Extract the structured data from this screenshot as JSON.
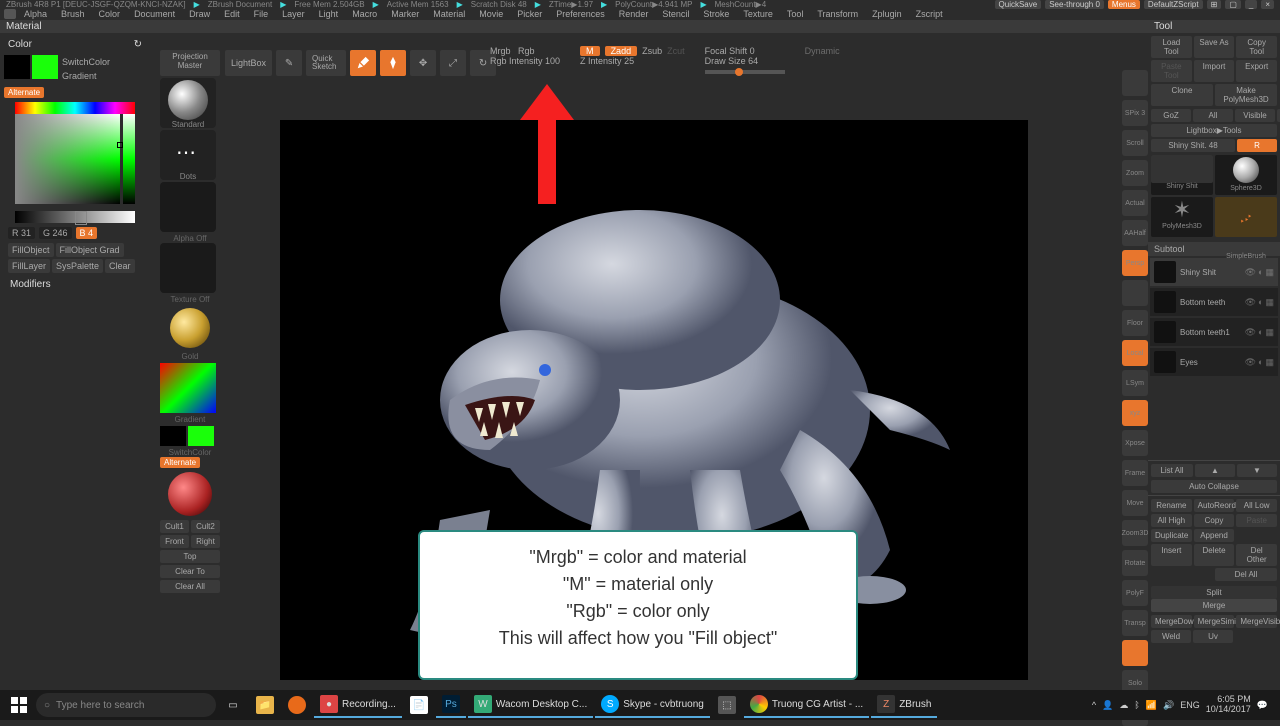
{
  "status": {
    "app": "ZBrush 4R8 P1 [DEUC-JSGF-QZQM-KNCI-NZAK]",
    "doc": "ZBrush Document",
    "mem": "Free Mem 2.504GB",
    "active": "Active Mem 1563",
    "scratch": "Scratch Disk 48",
    "ztime": "ZTime▶1.97",
    "poly": "PolyCount▶4.941 MP",
    "mesh": "MeshCount▶4",
    "quicksave": "QuickSave",
    "seethrough": "See-through 0",
    "menus": "Menus",
    "defscript": "DefaultZScript"
  },
  "menus": [
    "Alpha",
    "Brush",
    "Color",
    "Document",
    "Draw",
    "Edit",
    "File",
    "Layer",
    "Light",
    "Macro",
    "Marker",
    "Material",
    "Movie",
    "Picker",
    "Preferences",
    "Render",
    "Stencil",
    "Stroke",
    "Texture",
    "Tool",
    "Transform",
    "Zplugin",
    "Zscript"
  ],
  "panel_titles": {
    "material": "Material",
    "color": "Color",
    "tool": "Tool"
  },
  "color": {
    "switch": "SwitchColor",
    "gradient": "Gradient",
    "alternate": "Alternate",
    "r": "R 31",
    "g": "G 246",
    "b": "B 4",
    "fillobj": "FillObject",
    "fillgrad": "FillObject Grad",
    "filllayer": "FillLayer",
    "syspal": "SysPalette",
    "clear": "Clear",
    "modifiers": "Modifiers",
    "swatch_fg": "#1aff0a",
    "swatch_bg": "#000000"
  },
  "brush_col": {
    "pm1": "Projection",
    "pm2": "Master",
    "standard": "Standard",
    "dots": "Dots",
    "alpha_off": "Alpha Off",
    "texture_off": "Texture Off",
    "gold": "Gold",
    "gradient": "Gradient",
    "switch": "SwitchColor",
    "alternate": "Alternate",
    "cult1": "Cult1",
    "cult2": "Cult2",
    "front": "Front",
    "right": "Right",
    "top": "Top",
    "clear_to": "Clear To",
    "clear_all": "Clear All"
  },
  "top_tools": {
    "lightbox": "LightBox",
    "quick_sketch": "Quick\nSketch",
    "edit": "Edit",
    "draw": "Draw",
    "move": "Move",
    "scale": "Scale",
    "rotate": "Rotate"
  },
  "params": {
    "mrgb": "Mrgb",
    "rgb": "Rgb",
    "m": "M",
    "zadd": "Zadd",
    "zsub": "Zsub",
    "zcut": "Zcut",
    "rgb_int": "Rgb Intensity 100",
    "z_int": "Z Intensity 25",
    "focal": "Focal Shift 0",
    "draw_size": "Draw Size 64",
    "dynamic": "Dynamic"
  },
  "right_strip": [
    "",
    "SPix 3",
    "Scroll",
    "Zoom",
    "Actual",
    "AAHalf",
    "Persp",
    "",
    "Floor",
    "Local",
    "LSym",
    "",
    "Xpose",
    "Frame",
    "Move",
    "Zoom3D",
    "Rotate",
    "PolyF",
    "Transp",
    "",
    "Solo"
  ],
  "right_strip_on": [
    5,
    7,
    12
  ],
  "tool": {
    "load": "Load Tool",
    "saveas": "Save As",
    "copy": "Copy Tool",
    "paste": "Paste Tool",
    "import": "Import",
    "export": "Export",
    "clone": "Clone",
    "makepm": "Make PolyMesh3D",
    "goz": "GoZ",
    "all": "All",
    "visible": "Visible",
    "r": "R",
    "lightbox": "Lightbox▶Tools",
    "shiny": "Shiny Shit. 48",
    "thumbs": [
      "Shiny Shit",
      "Sphere3D",
      "PolyMesh3D",
      "SimpleBrush"
    ],
    "subtool_hdr": "Subtool",
    "subtools": [
      "Shiny Shit",
      "Bottom teeth",
      "Bottom teeth1",
      "Eyes"
    ],
    "listall": "List All",
    "autocol": "Auto Collapse",
    "rename": "Rename",
    "autoreorder": "AutoReorder",
    "alllow": "All Low",
    "allhigh": "All High",
    "copy2": "Copy",
    "paste2": "Paste",
    "dup": "Duplicate",
    "append": "Append",
    "insert": "Insert",
    "delete": "Delete",
    "delother": "Del Other",
    "delall": "Del All",
    "split": "Split",
    "merge": "Merge",
    "mergedown": "MergeDown",
    "mergesimilar": "MergeSimilar",
    "mergevisible": "MergeVisible",
    "weld": "Weld",
    "uv": "Uv"
  },
  "info": {
    "l1": "\"Mrgb\" = color and material",
    "l2": "\"M\" = material only",
    "l3": "\"Rgb\" = color only",
    "l4": "This will affect how you \"Fill object\""
  },
  "taskbar": {
    "search": "Type here to search",
    "items": [
      "Recording...",
      "",
      "Wacom Desktop C...",
      "Skype - cvbtruong",
      "",
      "Truong CG Artist - ...",
      "ZBrush"
    ],
    "time": "6:05 PM",
    "date": "10/14/2017",
    "lang": "ENG"
  }
}
